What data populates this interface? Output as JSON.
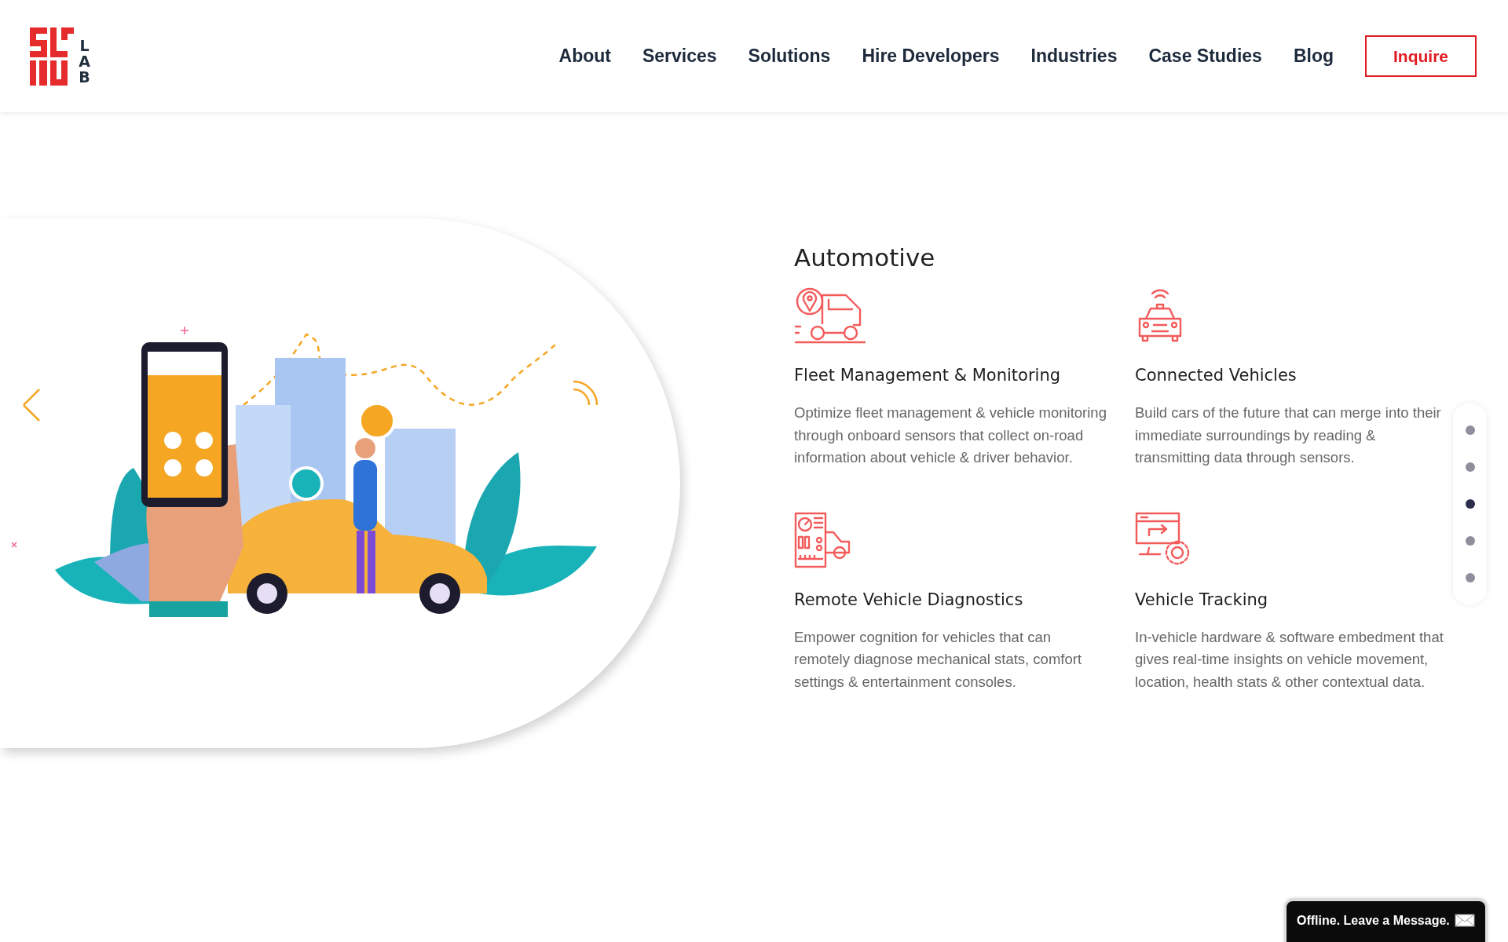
{
  "logo": {
    "text": "LAB"
  },
  "nav": [
    {
      "label": "About"
    },
    {
      "label": "Services"
    },
    {
      "label": "Solutions"
    },
    {
      "label": "Hire Developers"
    },
    {
      "label": "Industries"
    },
    {
      "label": "Case Studies"
    },
    {
      "label": "Blog"
    }
  ],
  "cta": {
    "label": "Inquire"
  },
  "section": {
    "title": "Automotive",
    "features": [
      {
        "kind": "truck",
        "title": "Fleet Management & Monitoring",
        "text": "Optimize fleet management & vehicle monitoring through onboard sensors that collect on-road information about vehicle & driver behavior."
      },
      {
        "kind": "car",
        "title": "Connected Vehicles",
        "text": "Build cars of the future that can merge into their immediate surroundings by reading & transmitting data through sensors."
      },
      {
        "kind": "diagnostics",
        "title": "Remote Vehicle Diagnostics",
        "text": "Empower cognition for vehicles that can remotely diagnose mechanical stats, comfort settings & entertainment consoles."
      },
      {
        "kind": "tracking",
        "title": "Vehicle Tracking",
        "text": "In-vehicle hardware & software embedment that gives real-time insights on vehicle movement, location, health stats & other contextual data."
      }
    ]
  },
  "pager": [
    {
      "selected": false
    },
    {
      "selected": false
    },
    {
      "selected": true
    },
    {
      "selected": false
    },
    {
      "selected": false
    }
  ],
  "chat": {
    "label": "Offline. Leave a Message."
  }
}
